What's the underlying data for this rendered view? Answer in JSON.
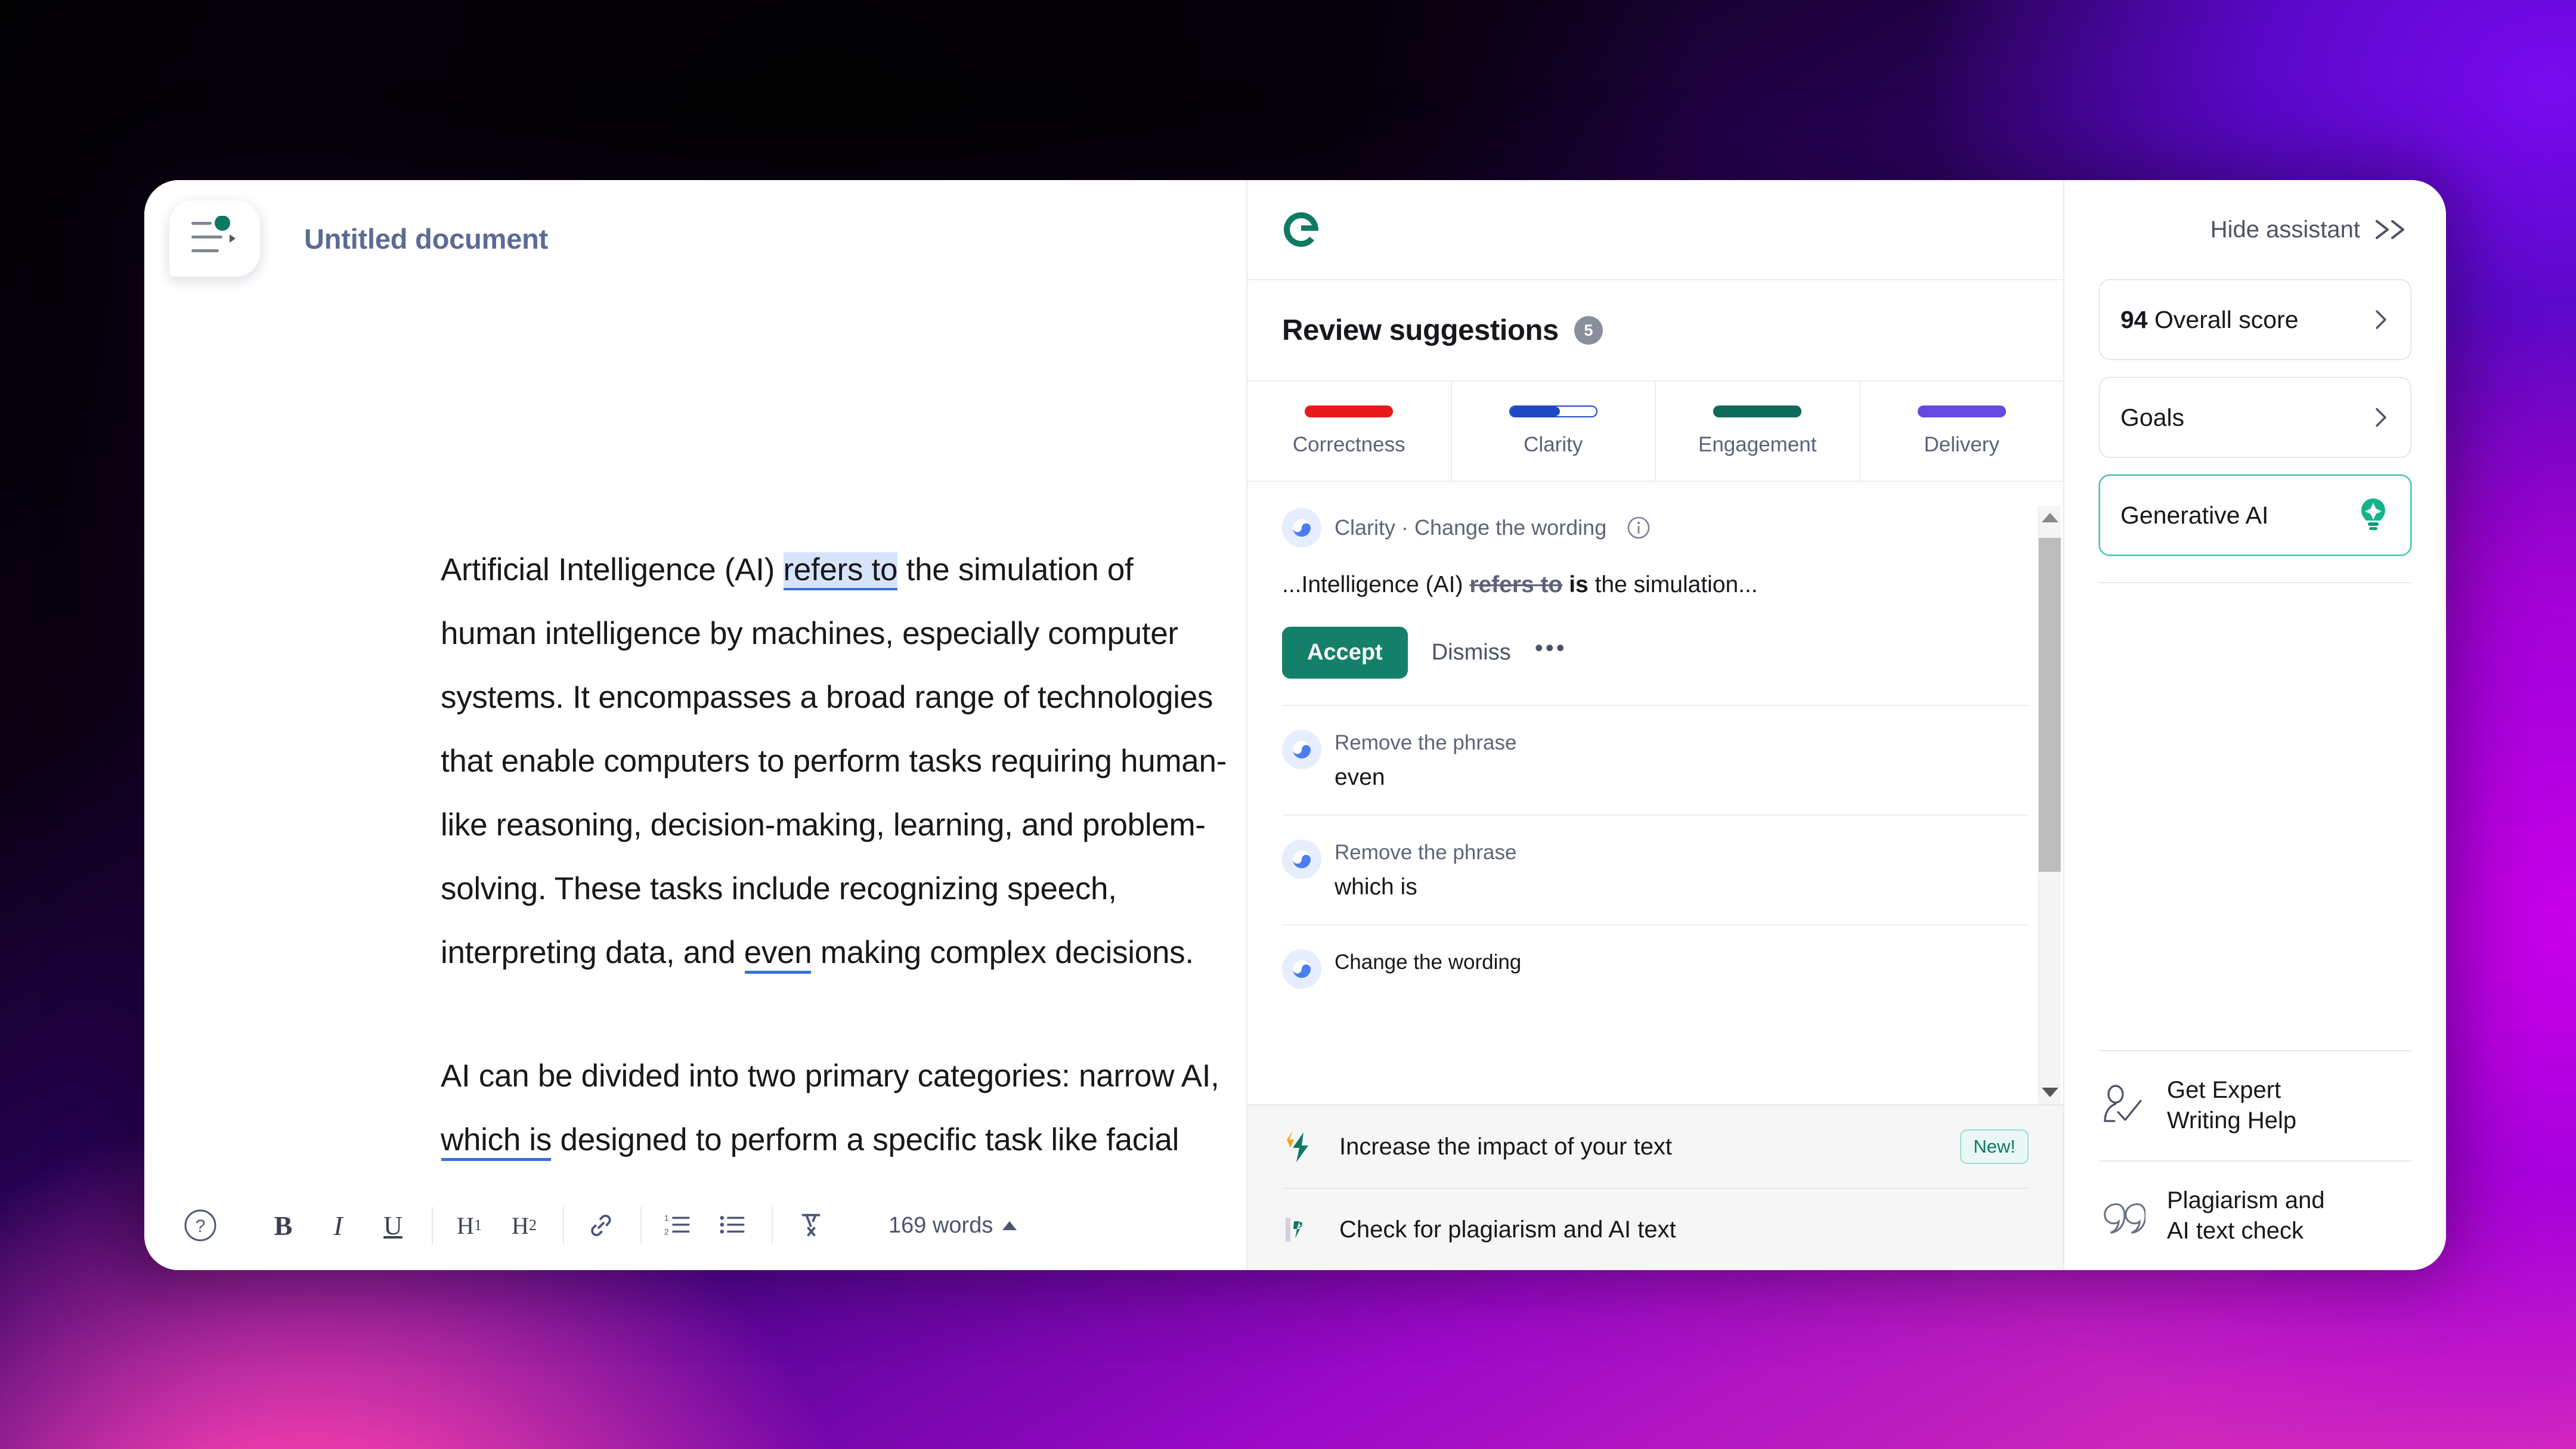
{
  "editor": {
    "doc_icon": "document-chip-icon",
    "title": "Untitled document",
    "paragraphs": [
      {
        "segments": [
          {
            "text": " Artificial Intelligence (AI) ",
            "style": "normal"
          },
          {
            "text": "refers to",
            "style": "highlight"
          },
          {
            "text": " the simulation of human intelligence by machines, especially computer systems. It encompasses a broad range of technologies that enable computers to perform tasks requiring human-like reasoning, decision-making, learning, and problem-solving. These tasks include recognizing speech, interpreting data, and ",
            "style": "normal"
          },
          {
            "text": "even",
            "style": "underline"
          },
          {
            "text": " making complex decisions.",
            "style": "normal"
          }
        ]
      },
      {
        "segments": [
          {
            "text": "AI can be divided into two primary categories: narrow AI, ",
            "style": "normal"
          },
          {
            "text": "which is",
            "style": "underline"
          },
          {
            "text": " designed to perform a specific task like facial recognition or language translation,",
            "style": "normal"
          }
        ]
      }
    ],
    "toolbar": {
      "help": "?",
      "bold": "B",
      "italic": "I",
      "underline": "U",
      "h1": "H",
      "h1_sub": "1",
      "h2": "H",
      "h2_sub": "2",
      "word_count": "169 words"
    }
  },
  "assistant": {
    "logo": "grammarly-logo-icon",
    "title": "Review suggestions",
    "count": "5",
    "tabs": [
      {
        "label": "Correctness",
        "color": "#e8191c",
        "fill_pct": 100
      },
      {
        "label": "Clarity",
        "color": "#1f49c4",
        "fill_pct": 58
      },
      {
        "label": "Engagement",
        "color": "#0f6b5c",
        "fill_pct": 100
      },
      {
        "label": "Delivery",
        "color": "#6649e0",
        "fill_pct": 100
      }
    ],
    "primary_suggestion": {
      "category": "Clarity · Change the wording",
      "preview_prefix": "...Intelligence (AI) ",
      "preview_strike": "refers to",
      "preview_bold": " is",
      "preview_suffix": " the simulation...",
      "accept_label": "Accept",
      "dismiss_label": "Dismiss",
      "more_label": "•••"
    },
    "other_suggestions": [
      {
        "category": "Remove the phrase",
        "phrase": "even"
      },
      {
        "category": "Remove the phrase",
        "phrase": "which is"
      },
      {
        "category": "Change the wording",
        "phrase": ""
      }
    ],
    "footer_items": [
      {
        "icon": "bolt-icon",
        "label": "Increase the impact of your text",
        "badge": "New!"
      },
      {
        "icon": "quote-icon",
        "label": "Check for plagiarism and AI text",
        "badge": ""
      }
    ]
  },
  "sidebar": {
    "hide_label": "Hide assistant",
    "cards": [
      {
        "score": "94",
        "label": "Overall score",
        "accent": false
      },
      {
        "score": "",
        "label": "Goals",
        "accent": false
      },
      {
        "score": "",
        "label": "Generative AI",
        "accent": true
      }
    ],
    "bottom_items": [
      {
        "icon": "expert-writer-icon",
        "line1": "Get Expert",
        "line2": "Writing Help"
      },
      {
        "icon": "quote-marks-icon",
        "line1": "Plagiarism and",
        "line2": "AI text check"
      }
    ]
  },
  "colors": {
    "brand_green": "#14806a",
    "accent_teal": "#46c2b2",
    "suggestion_blue": "#3b6fd4",
    "highlight_blue": "#d6e4fb"
  }
}
